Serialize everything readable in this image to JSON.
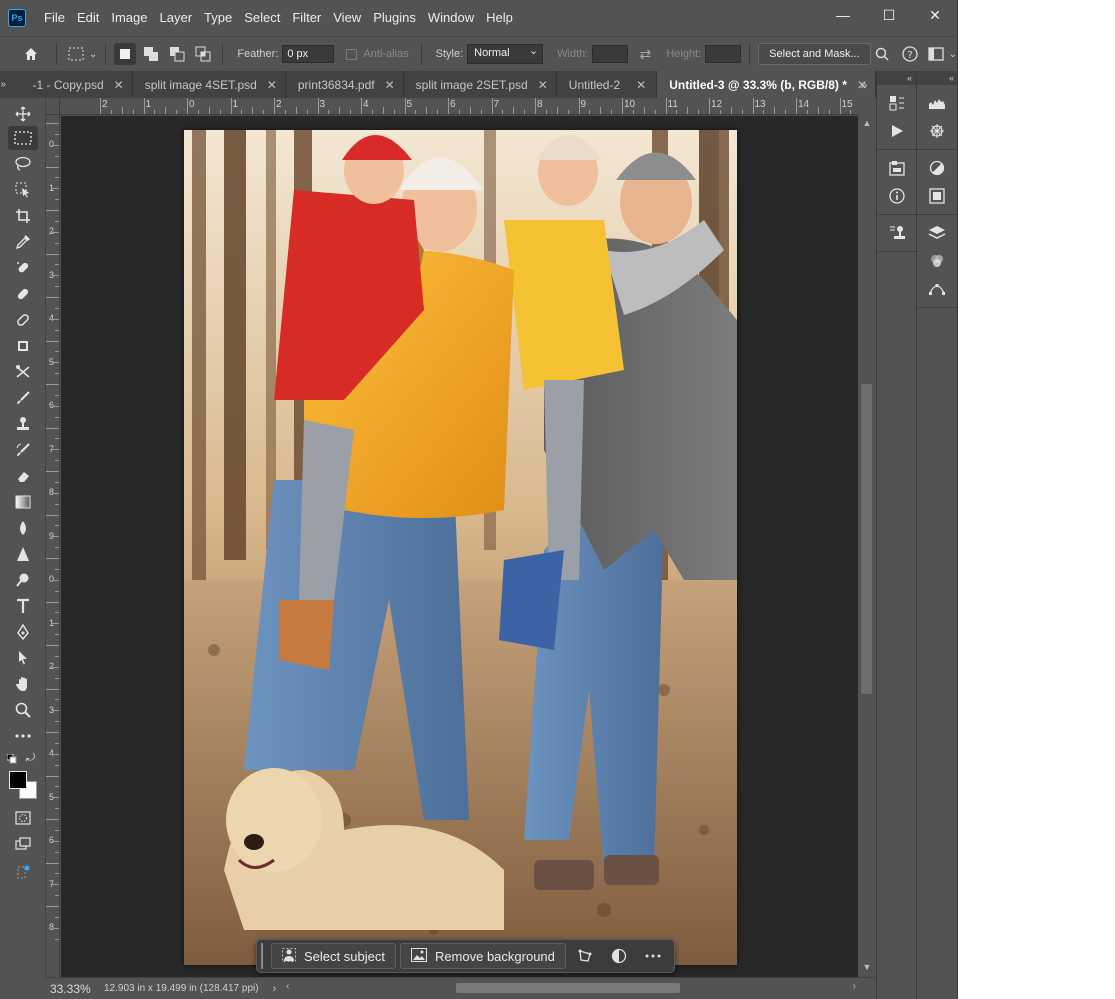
{
  "menubar": {
    "logo": "Ps",
    "items": [
      "File",
      "Edit",
      "Image",
      "Layer",
      "Type",
      "Select",
      "Filter",
      "View",
      "Plugins",
      "Window",
      "Help"
    ],
    "window_controls": {
      "minimize": "—",
      "maximize": "☐",
      "close": "✕"
    }
  },
  "options": {
    "feather_label": "Feather:",
    "feather_value": "0 px",
    "antialias_label": "Anti-alias",
    "style_label": "Style:",
    "style_value": "Normal",
    "width_label": "Width:",
    "height_label": "Height:",
    "select_mask_label": "Select and Mask..."
  },
  "tabs": [
    {
      "label": "-1 - Copy.psd",
      "active": false
    },
    {
      "label": "split image 4SET.psd",
      "active": false
    },
    {
      "label": "print36834.pdf",
      "active": false
    },
    {
      "label": "split image 2SET.psd",
      "active": false
    },
    {
      "label": "Untitled-2",
      "active": false
    },
    {
      "label": "Untitled-3 @ 33.3% (b, RGB/8) *",
      "active": true
    }
  ],
  "tab_close_glyph": "✕",
  "ruler_top": [
    "2",
    "1",
    "0",
    "1",
    "2",
    "3",
    "4",
    "5",
    "6",
    "7",
    "8",
    "9",
    "10",
    "11",
    "12",
    "13",
    "14",
    "15"
  ],
  "ruler_left": [
    "0",
    "1",
    "2",
    "3",
    "4",
    "5",
    "6",
    "7",
    "8",
    "9",
    "0",
    "1",
    "2",
    "3",
    "4",
    "5",
    "6",
    "7",
    "8"
  ],
  "context_bar": {
    "select_subject": "Select subject",
    "remove_background": "Remove background"
  },
  "status": {
    "zoom": "33.33%",
    "doc_info": "12.903 in x 19.499 in (128.417 ppi)"
  },
  "colors": {
    "foreground": "#000000",
    "background": "#ffffff",
    "ui_panel": "#535353",
    "canvas_bg": "#282828"
  },
  "toolbar_icons": [
    "move-icon",
    "marquee-icon",
    "lasso-icon",
    "object-select-icon",
    "crop-icon",
    "eyedropper-icon",
    "spot-healing-icon",
    "healing-icon",
    "patch-icon",
    "content-aware-icon",
    "remove-tool-icon",
    "brush-icon",
    "stamp-icon",
    "history-brush-icon",
    "eraser-icon",
    "gradient-icon",
    "blur-icon",
    "sharpen-icon",
    "dodge-icon",
    "type-icon",
    "pen-icon",
    "path-select-icon",
    "hand-icon",
    "zoom-icon",
    "more-tools-icon"
  ]
}
